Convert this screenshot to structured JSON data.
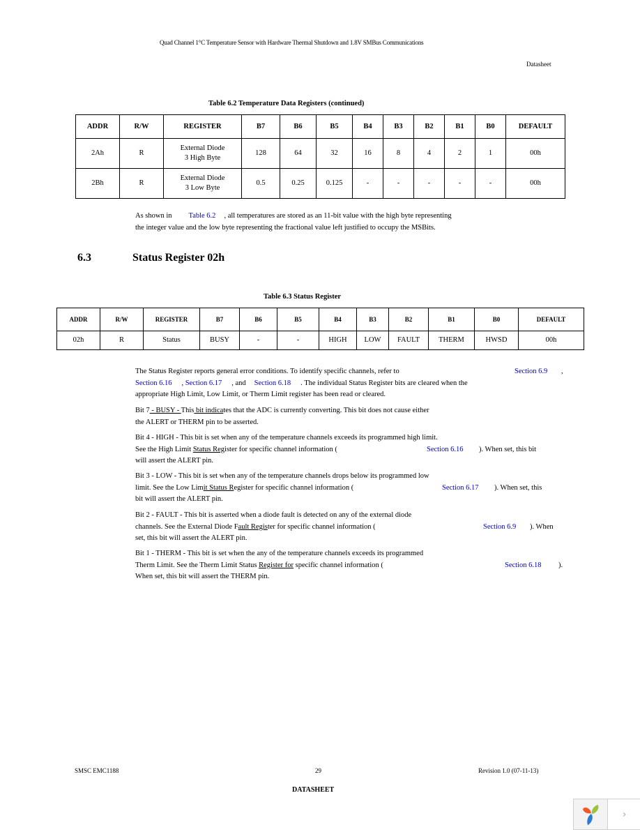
{
  "header": {
    "title": "Quad Channel 1°C Temperature Sensor with Hardware Thermal Shutdown and 1.8V SMBus Communications",
    "right": "Datasheet"
  },
  "table62": {
    "caption": "Table 6.2  Temperature Data Registers (continued)",
    "columns": [
      "ADDR",
      "R/W",
      "REGISTER",
      "B7",
      "B6",
      "B5",
      "B4",
      "B3",
      "B2",
      "B1",
      "B0",
      "DEFAULT"
    ],
    "rows": [
      {
        "addr": "2Ah",
        "rw": "R",
        "reg_line1": "External Diode",
        "reg_line2": "3 High Byte",
        "bits": [
          "128",
          "64",
          "32",
          "16",
          "8",
          "4",
          "2",
          "1"
        ],
        "default": "00h"
      },
      {
        "addr": "2Bh",
        "rw": "R",
        "reg_line1": "External Diode",
        "reg_line2": "3 Low Byte",
        "bits": [
          "0.5",
          "0.25",
          "0.125",
          "-",
          "-",
          "-",
          "-",
          "-"
        ],
        "default": "00h"
      }
    ]
  },
  "para1": {
    "pre": "As shown in",
    "link": "Table 6.2",
    "post": ", all temperatures are stored as an 11-bit value with the high byte representing",
    "line2": "the integer value and the low byte representing the fractional value left justified to occupy the MSBits."
  },
  "section": {
    "number": "6.3",
    "title": "Status Register 02h"
  },
  "table63": {
    "caption": "Table 6.3  Status Register",
    "columns": [
      "ADDR",
      "R/W",
      "REGISTER",
      "B7",
      "B6",
      "B5",
      "B4",
      "B3",
      "B2",
      "B1",
      "B0",
      "DEFAULT"
    ],
    "rows": [
      {
        "addr": "02h",
        "rw": "R",
        "reg": "Status",
        "bits": [
          "BUSY",
          "-",
          "-",
          "HIGH",
          "LOW",
          "FAULT",
          "THERM",
          "HWSD"
        ],
        "default": "00h"
      }
    ]
  },
  "status_desc": {
    "l1_pre": "The Status Register reports general error conditions. To identify specific channels, refer to",
    "l1_link": "Section 6.9",
    "l1_post": ",",
    "l2_link1": "Section 6.16",
    "l2_sep1": ",",
    "l2_link2": "Section 6.17",
    "l2_sep2": ", and",
    "l2_link3": "Section 6.18",
    "l2_post": ". The individual Status Register bits are cleared when the",
    "l3": "appropriate High Limit, Low Limit, or Therm Limit register has been read or cleared."
  },
  "bit7": {
    "a": "Bit 7",
    "b": " - BUSY - ",
    "c": "This",
    "d": " bit indica",
    "e": "tes that the ADC is currently converting. This bit does not cause either",
    "line2": "the ALERT or THERM pin to be asserted."
  },
  "bit4": {
    "line1": "Bit 4 - HIGH - This bit is set when any of the temperature channels exceeds its programmed high limit.",
    "l2a": "See the High Limit ",
    "l2u": "Status Reg",
    "l2b": "ister for specific channel information (",
    "link": "Section 6.16",
    "l2post": "). When set, this bit",
    "line3": "will assert the ALERT pin."
  },
  "bit3": {
    "line1": "Bit 3 - LOW - This bit is set when any of the temperature channels drops below its programmed low",
    "l2a": "limit. See the Low Lim",
    "l2u": "it Status R",
    "l2b": "egister for specific channel information (",
    "link": "Section 6.17",
    "l2post": "). When set, this",
    "line3": "bit will assert the ALERT pin."
  },
  "bit2": {
    "line1": "Bit 2 - FAULT - This bit is asserted when a diode fault is detected on any of the external diode",
    "l2a": "channels. See the External Diode F",
    "l2u": "ault Regis",
    "l2b": "ter for specific channel information (",
    "link": "Section 6.9",
    "l2post": "). When",
    "line3": "set, this bit will assert the ALERT pin."
  },
  "bit1": {
    "line1": "Bit 1 - THERM - This bit is set when the any of the temperature channels exceeds its programmed",
    "l2a": "Therm Limit. See the Therm Limit Status ",
    "l2u": "Register for",
    "l2b": " specific channel information (",
    "link": "Section 6.18",
    "l2post": ").",
    "line3": "When set, this bit will assert the THERM pin."
  },
  "footer": {
    "left": "SMSC EMC1188",
    "page": "29",
    "right": "Revision 1.0 (07-11-13)",
    "center": "DATASHEET"
  },
  "widget": {
    "logo_icon": "app-logo-icon",
    "next_icon": "chevron-right-icon",
    "next_glyph": "›"
  }
}
